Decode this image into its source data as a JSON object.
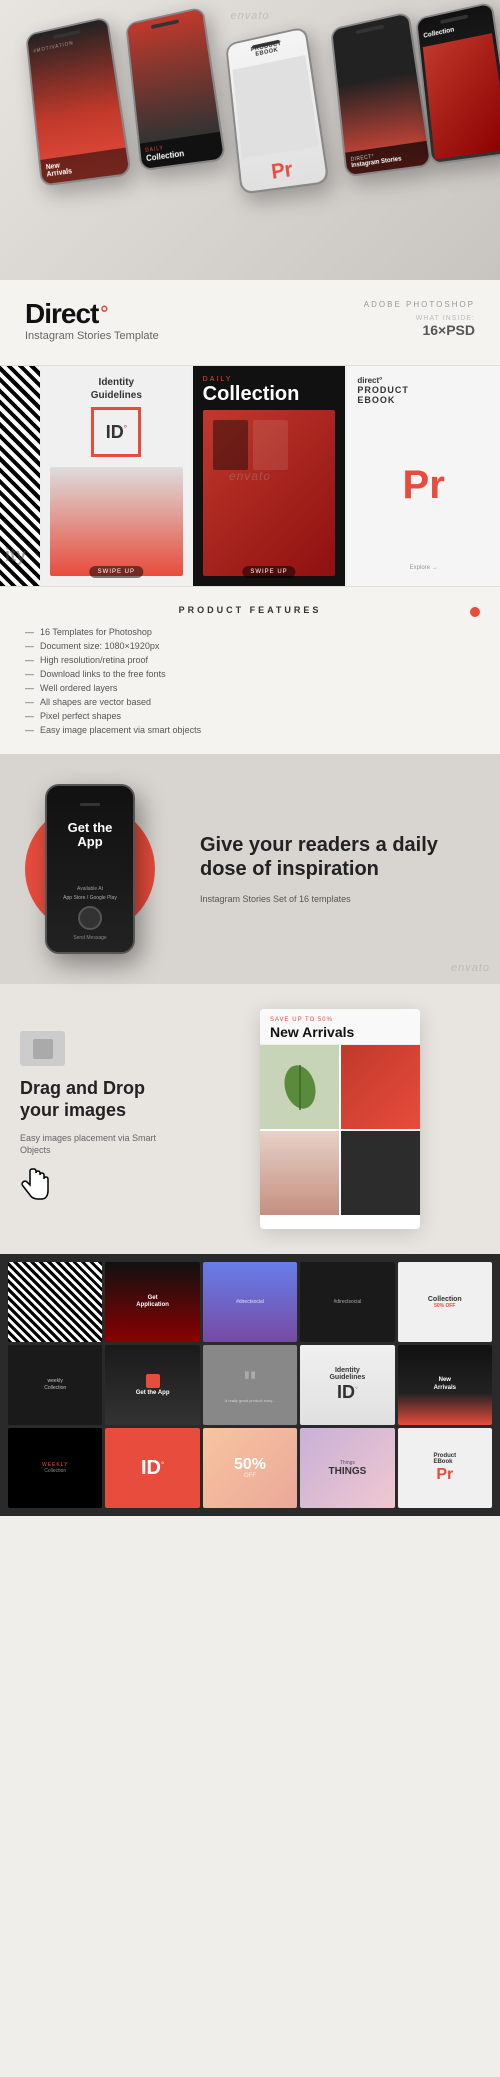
{
  "hero": {
    "phones": [
      {
        "style": "screen-red",
        "position": "iso-1"
      },
      {
        "style": "screen-dark",
        "position": "iso-2"
      },
      {
        "style": "screen-light",
        "position": "iso-3"
      },
      {
        "style": "screen-mixed",
        "position": "iso-4"
      },
      {
        "style": "screen-dark",
        "position": "iso-5"
      }
    ],
    "watermark": "envato"
  },
  "brand": {
    "title": "Direct",
    "degree": "°",
    "subtitle": "Instagram Stories Template",
    "adobe_label": "ADOBE PHOTOSHOP",
    "what_inside": "WHAT INSIDE:",
    "psd_count": "16×PSD"
  },
  "preview": {
    "card1": {
      "label": "Identity",
      "sub": "Guidelines",
      "id_text": "ID°",
      "swipe": "Swipe Up"
    },
    "card2": {
      "daily": "DAILY",
      "collection": "Collection",
      "swipe": "Swipe Up"
    },
    "card3": {
      "label": "direct°",
      "product": "Product EBook",
      "pr": "Pr"
    }
  },
  "features": {
    "title": "PRODUCT FEATURES",
    "items": [
      "16 Templates for Photoshop",
      "Document size: 1080×1920px",
      "High resolution/retina proof",
      "Download links to the free fonts",
      "Well ordered layers",
      "All shapes are vector based",
      "Pixel perfect shapes",
      "Easy image placement via smart objects"
    ]
  },
  "app_promo": {
    "get_text": "Get the App",
    "tagline": "Give your readers a daily dose of inspiration",
    "subtitle": "Instagram Stories Set of 16 templates",
    "watermark": "envato"
  },
  "arrivals": {
    "drag_title": "Drag and Drop your images",
    "drag_sub": "Easy images placement via Smart Objects",
    "heading": "New Arrivals",
    "sub_label": "SAVE UP TO 50%"
  },
  "bottom_grid": {
    "row1": [
      {
        "bg": "bg-stripe",
        "text": ""
      },
      {
        "bg": "bg-darkred",
        "text": "Get\nApplication"
      },
      {
        "bg": "bg-photo1",
        "text": ""
      },
      {
        "bg": "bg-dark",
        "text": "#directsocial"
      },
      {
        "bg": "bg-light",
        "text": "Collection"
      }
    ],
    "row2": [
      {
        "bg": "bg-dark",
        "text": "weekly\nCollection"
      },
      {
        "bg": "bg-warm",
        "text": "Get the App"
      },
      {
        "bg": "bg-grey",
        "text": "\""
      },
      {
        "bg": "bg-forest",
        "text": "Identity\nGuidelines"
      },
      {
        "bg": "bg-night",
        "text": "New\nArrivals"
      }
    ],
    "row3": [
      {
        "bg": "bg-black",
        "text": ""
      },
      {
        "bg": "bg-red",
        "text": "ID°"
      },
      {
        "bg": "bg-warm2",
        "text": "50%\nOFF"
      },
      {
        "bg": "bg-cool",
        "text": ""
      },
      {
        "bg": "bg-light",
        "text": "Pr"
      }
    ]
  },
  "watermark": "envato"
}
